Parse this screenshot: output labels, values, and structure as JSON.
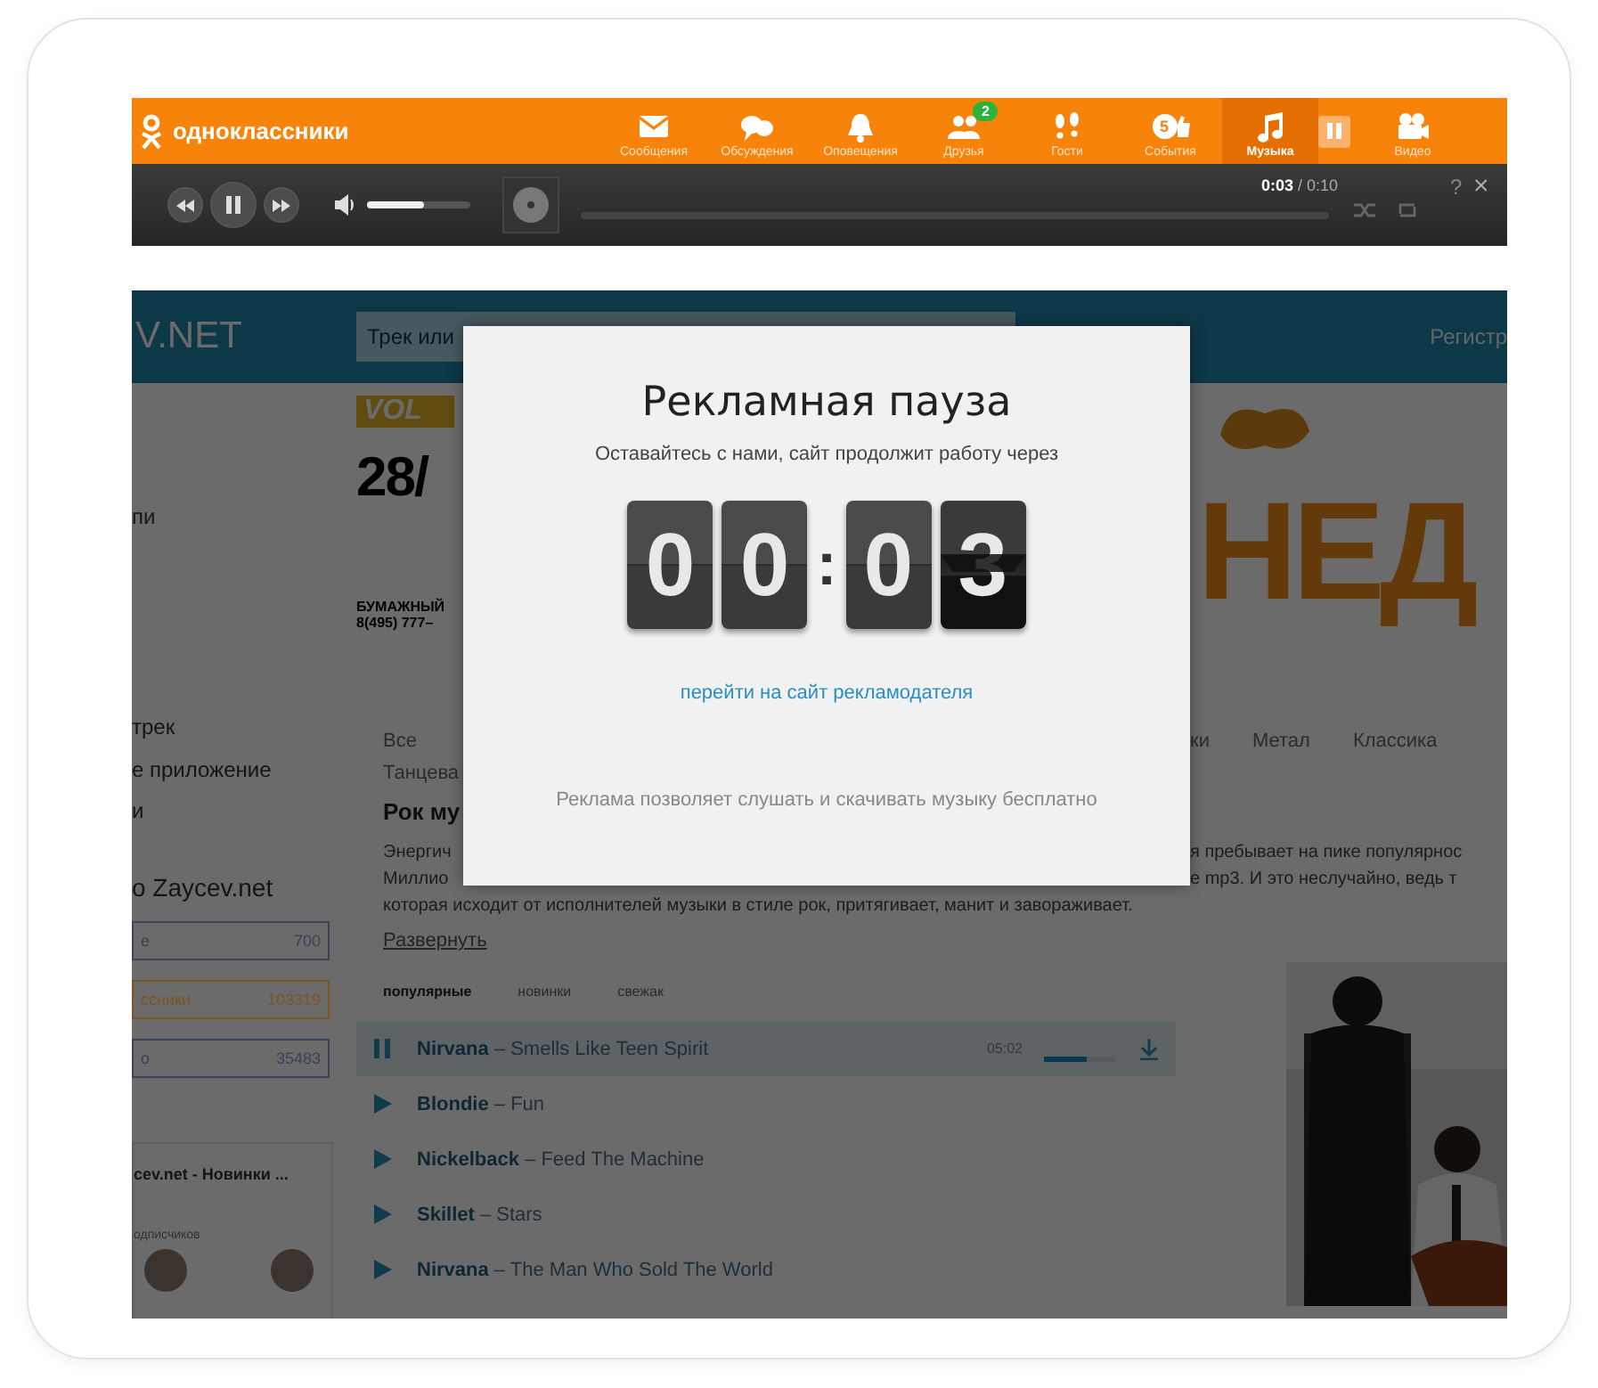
{
  "topbar": {
    "logo": "одноклассники",
    "nav": [
      {
        "label": "Сообщения",
        "selected": false
      },
      {
        "label": "Обсуждения",
        "selected": false
      },
      {
        "label": "Оповещения",
        "selected": false
      },
      {
        "label": "Друзья",
        "selected": false,
        "badge": "2"
      },
      {
        "label": "Гости",
        "selected": false
      },
      {
        "label": "События",
        "selected": false,
        "count": "5"
      },
      {
        "label": "Музыка",
        "selected": true
      },
      {
        "label": "Видео",
        "selected": false
      }
    ]
  },
  "player": {
    "volume": {
      "level": 0.55
    },
    "time_current": "0:03",
    "time_total": " / 0:10",
    "help": "?",
    "close": "×"
  },
  "site": {
    "logo": "V.NET",
    "search": {
      "placeholder": "Трек или"
    },
    "register": "Регистр",
    "sidebar": {
      "fragments": [
        "пи",
        "трек",
        "е приложение",
        "и",
        "o Zaycev.net"
      ],
      "counters": [
        {
          "label": "е",
          "count": "700",
          "color": "#3a4356"
        },
        {
          "label": "ссники",
          "count": "103319",
          "color": "#7d5422"
        },
        {
          "label": "о",
          "count": "35483",
          "color": "#3a4356"
        }
      ],
      "group": {
        "title": "cev.net - Новинки ...",
        "caption": "одписчиков"
      }
    },
    "banner_left": {
      "logo": "VOL",
      "date": "28/",
      "line_1": "БУМАЖНЫЙ",
      "line_2": "8(495) 777–"
    },
    "banner_right": {
      "text": "НЕД"
    },
    "genres": {
      "left": [
        "Все"
      ],
      "right": [
        "ки",
        "Метал",
        "Классика"
      ]
    },
    "genre_cut": "Танцева",
    "heading": "Рок му",
    "paragraph": [
      {
        "left": "Энергич",
        "right": "я пребывает на пике популярнос"
      },
      {
        "left": "Миллио",
        "right": "е mp3. И это неслучайно, ведь т"
      },
      {
        "left": "которая исходит от исполнителей музыки в стиле рок, притягивает, манит и завораживает."
      }
    ],
    "expand": "Развернуть",
    "subtabs": [
      {
        "label": "популярные",
        "selected": true
      },
      {
        "label": "новинки",
        "selected": false
      },
      {
        "label": "свежак",
        "selected": false
      }
    ],
    "tracks": [
      {
        "artist": "Nirvana",
        "title": " – Smells Like Teen Spirit",
        "playing": true,
        "duration": "05:02",
        "level": 0.6
      },
      {
        "artist": "Blondie",
        "title": " – Fun",
        "playing": false
      },
      {
        "artist": "Nickelback",
        "title": " – Feed The Machine",
        "playing": false
      },
      {
        "artist": "Skillet",
        "title": " – Stars",
        "playing": false
      },
      {
        "artist": "Nirvana",
        "title": " – The Man Who Sold The World",
        "playing": false
      }
    ]
  },
  "ad_modal": {
    "title": "Рекламная пауза",
    "subtitle": "Оставайтесь с нами, сайт продолжит работу через",
    "digits": [
      {
        "value": "0",
        "flipping": false
      },
      {
        "value": "0",
        "flipping": false
      },
      {
        "value": "0",
        "flipping": false
      },
      {
        "value": "3",
        "flipping": true
      }
    ],
    "separator": ":",
    "link": "перейти на сайт рекламодателя",
    "footer": "Реклама позволяет слушать и скачивать музыку бесплатно"
  }
}
